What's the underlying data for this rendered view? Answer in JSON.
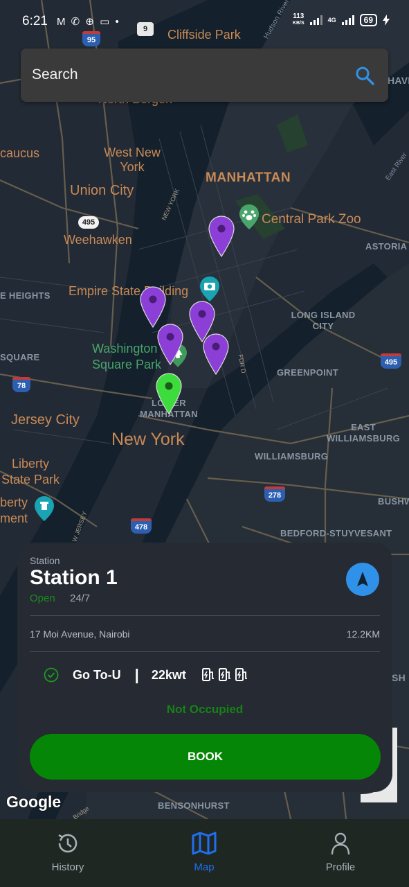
{
  "status_bar": {
    "time": "6:21",
    "notification_icons": "M ✆ ⊕ ▭ •",
    "net_speed_value": "113",
    "net_speed_unit": "KB/S",
    "network": "4G",
    "battery": "69"
  },
  "search": {
    "placeholder": "Search"
  },
  "map": {
    "labels": {
      "cliffside_park": "Cliffside Park",
      "hudson_river": "Hudson River",
      "north_bergen": "North Bergen",
      "secaucus": "caucus",
      "west_new_york": "West New York",
      "union_city": "Union City",
      "weehawken": "Weehawken",
      "manhattan": "MANHATTAN",
      "central_park_zoo": "Central Park Zoo",
      "astoria": "ASTORIA",
      "empire_state": "Empire State Building",
      "heights": "E HEIGHTS",
      "long_island_city": "LONG ISLAND CITY",
      "washington_square": "Washington Square Park",
      "square": "SQUARE",
      "greenpoint": "GREENPOINT",
      "lower_manhattan": "LOWER MANHATTAN",
      "jersey_city": "Jersey City",
      "new_york": "New York",
      "east_williamsburg": "EAST WILLIAMSBURG",
      "williamsburg": "WILLIAMSBURG",
      "liberty_state_park": "Liberty State Park",
      "liberty_monument": "berty ment",
      "bushwick": "BUSHW",
      "bedford": "BEDFORD-STUYVESANT",
      "bensonhurst": "BENSONHURST",
      "new_york_road": "NEW YORK",
      "fdr": "FDR D",
      "new_jersey": "W JERSEY",
      "east_river": "East River",
      "bridge": "Bridge",
      "sh": "SH",
      "have": "HAVE"
    },
    "shields": {
      "i95": "95",
      "r9": "9",
      "r495w": "495",
      "i495": "495",
      "i78": "78",
      "i278": "278",
      "i478": "478"
    },
    "attribution": "Google"
  },
  "station": {
    "kind_label": "Station",
    "name": "Station 1",
    "status": "Open",
    "hours": "24/7",
    "address": "17 Moi Avenue, Nairobi",
    "distance": "12.2KM",
    "provider": "Go To-U",
    "separator": "|",
    "power": "22kwt",
    "occupancy": "Not Occupied",
    "book_label": "BOOK"
  },
  "bottom_nav": {
    "history": "History",
    "map": "Map",
    "profile": "Profile"
  },
  "colors": {
    "accent_blue": "#2f92e8",
    "pin_purple": "#8c3fd6",
    "pin_green": "#3ddc3d",
    "book_green": "#068606",
    "nav_active": "#1f6ff0"
  }
}
